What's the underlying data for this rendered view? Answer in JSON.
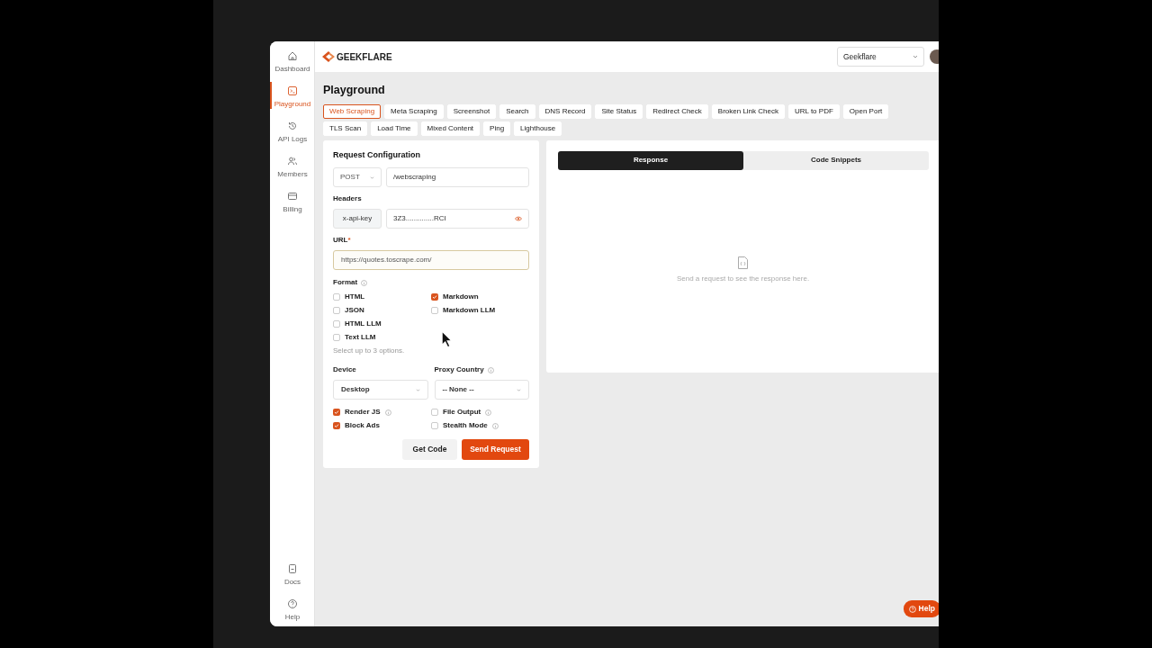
{
  "sidebar": {
    "items": [
      {
        "label": "Dashboard",
        "selected": false
      },
      {
        "label": "Playground",
        "selected": true
      },
      {
        "label": "API Logs",
        "selected": false
      },
      {
        "label": "Members",
        "selected": false
      },
      {
        "label": "Billing",
        "selected": false
      }
    ],
    "bottom_items": [
      {
        "label": "Docs"
      },
      {
        "label": "Help"
      }
    ]
  },
  "header": {
    "logo": "GEEKFLARE",
    "workspace": "Geekflare"
  },
  "page_title": "Playground",
  "tabs": [
    {
      "label": "Web Scraping",
      "selected": true
    },
    {
      "label": "Meta Scraping",
      "selected": false
    },
    {
      "label": "Screenshot",
      "selected": false
    },
    {
      "label": "Search",
      "selected": false
    },
    {
      "label": "DNS Record",
      "selected": false
    },
    {
      "label": "Site Status",
      "selected": false
    },
    {
      "label": "Redirect Check",
      "selected": false
    },
    {
      "label": "Broken Link Check",
      "selected": false
    },
    {
      "label": "URL to PDF",
      "selected": false
    },
    {
      "label": "Open Port",
      "selected": false
    },
    {
      "label": "TLS Scan",
      "selected": false
    },
    {
      "label": "Load Time",
      "selected": false
    },
    {
      "label": "Mixed Content",
      "selected": false
    },
    {
      "label": "Ping",
      "selected": false
    },
    {
      "label": "Lighthouse",
      "selected": false
    }
  ],
  "request": {
    "title": "Request Configuration",
    "method": "POST",
    "endpoint": "/webscraping",
    "headers_label": "Headers",
    "header_key": "x-api-key",
    "header_value": "3Z3..............RCI",
    "url_label": "URL",
    "url_required": "*",
    "url_value": "https://quotes.toscrape.com/",
    "format_label": "Format",
    "format_columns": [
      [
        {
          "label": "HTML",
          "checked": false
        },
        {
          "label": "JSON",
          "checked": false
        },
        {
          "label": "HTML LLM",
          "checked": false
        },
        {
          "label": "Text LLM",
          "checked": false
        }
      ],
      [
        {
          "label": "Markdown",
          "checked": true
        },
        {
          "label": "Markdown LLM",
          "checked": false
        }
      ]
    ],
    "format_hint": "Select up to 3 options.",
    "device_label": "Device",
    "device_value": "Desktop",
    "proxy_label": "Proxy Country",
    "proxy_value": "-- None --",
    "options": [
      {
        "label": "Render JS",
        "checked": true,
        "info": true
      },
      {
        "label": "File Output",
        "checked": false,
        "info": true
      },
      {
        "label": "Block Ads",
        "checked": true,
        "info": false
      },
      {
        "label": "Stealth Mode",
        "checked": false,
        "info": true
      }
    ],
    "buttons": [
      {
        "label": "Get Code",
        "kind": "secondary"
      },
      {
        "label": "Send Request",
        "kind": "primary"
      }
    ]
  },
  "response": {
    "tabs": [
      {
        "label": "Response",
        "selected": true
      },
      {
        "label": "Code Snippets",
        "selected": false
      }
    ],
    "empty_text": "Send a request to see the response here."
  },
  "help_button": "Help"
}
